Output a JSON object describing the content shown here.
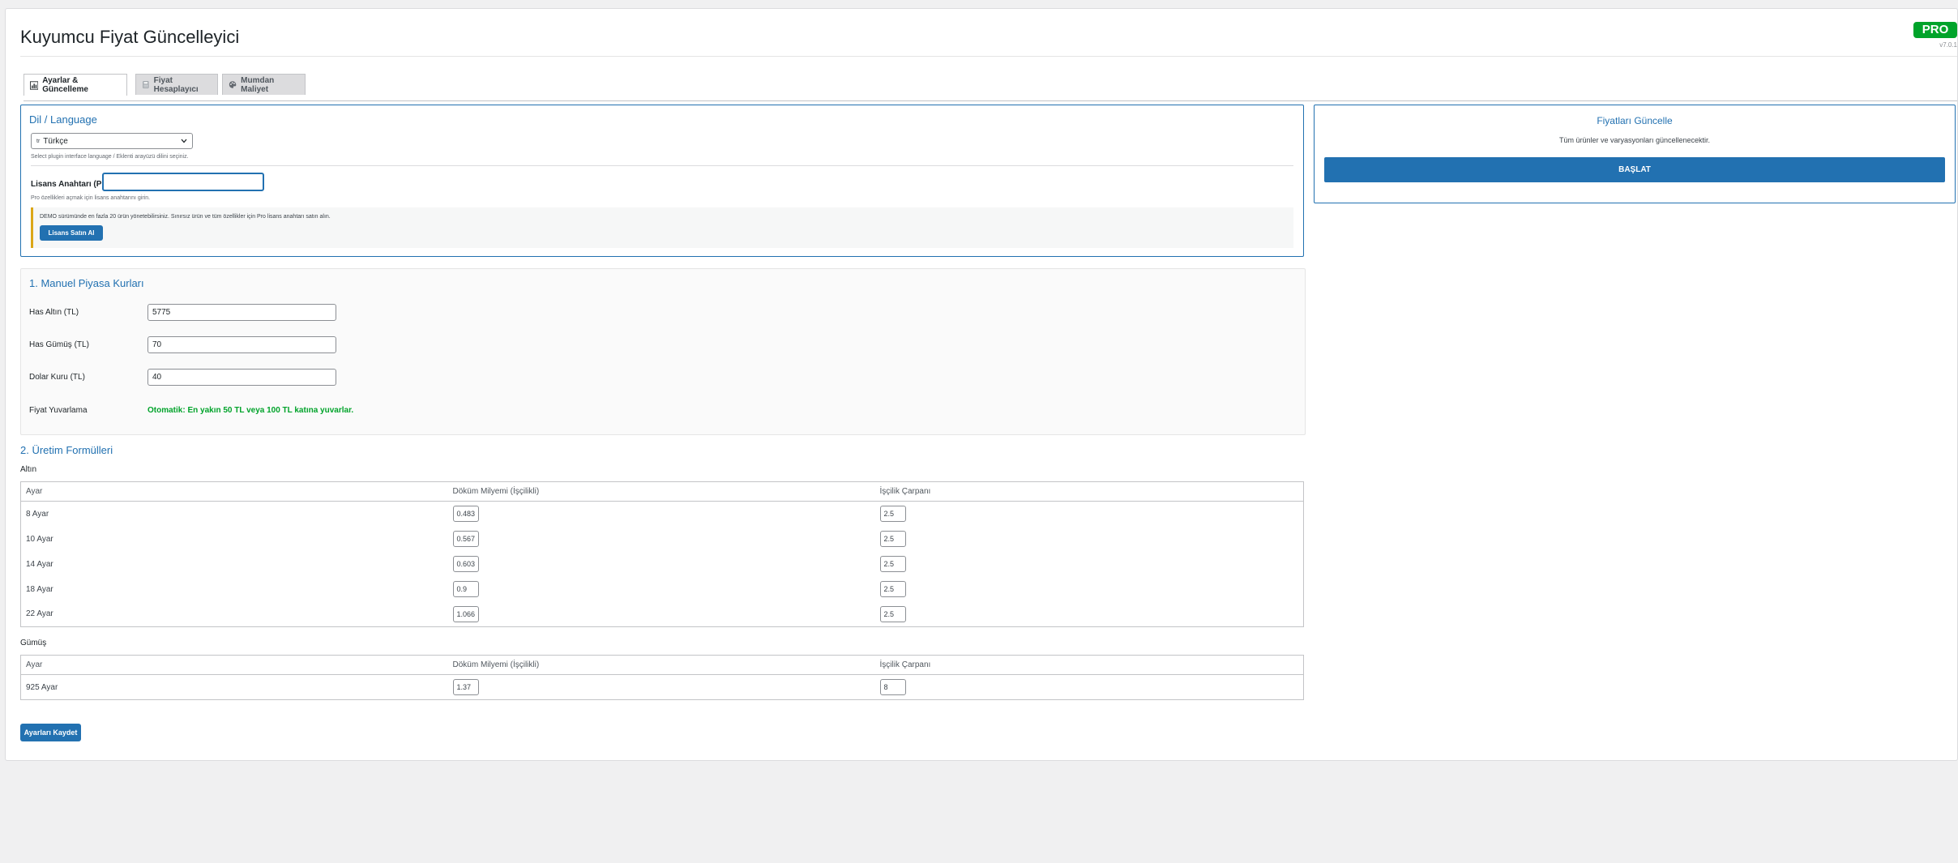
{
  "header": {
    "title": "Kuyumcu Fiyat Güncelleyici",
    "badge": "PRO",
    "version": "v7.0.1"
  },
  "tabs": [
    {
      "label": "Ayarlar & Güncelleme",
      "icon": "chart-icon"
    },
    {
      "label": "Fiyat Hesaplayıcı",
      "icon": "calculator-icon"
    },
    {
      "label": "Mumdan Maliyet",
      "icon": "palette-icon"
    }
  ],
  "language": {
    "title": "Dil / Language",
    "selected": "Türkçe",
    "flag": "tr",
    "help": "Select plugin interface language / Eklenti arayüzü dilini seçiniz."
  },
  "license": {
    "label": "Lisans Anahtarı (Pro):",
    "value": "",
    "help": "Pro özellikleri açmak için lisans anahtarını girin.",
    "notice": "DEMO sürümünde en fazla 20 ürün yönetebilirsiniz. Sınırsız ürün ve tüm özellikler için Pro lisans anahtarı satın alın.",
    "buy_label": "Lisans Satın Al"
  },
  "market": {
    "title": "1. Manuel Piyasa Kurları",
    "rows": [
      {
        "label": "Has Altın (TL)",
        "value": "5775"
      },
      {
        "label": "Has Gümüş (TL)",
        "value": "70"
      },
      {
        "label": "Dolar Kuru (TL)",
        "value": "40"
      }
    ],
    "rounding_label": "Fiyat Yuvarlama",
    "rounding_value": "Otomatik: En yakın 50 TL veya 100 TL katına yuvarlar."
  },
  "formulas": {
    "title": "2. Üretim Formülleri",
    "columns": [
      "Ayar",
      "Döküm Milyemi (İşçilikli)",
      "İşçilik Çarpanı"
    ],
    "gold_label": "Altın",
    "gold_rows": [
      {
        "ayar": "8 Ayar",
        "milyem": "0.483",
        "carpan": "2.5"
      },
      {
        "ayar": "10 Ayar",
        "milyem": "0.567",
        "carpan": "2.5"
      },
      {
        "ayar": "14 Ayar",
        "milyem": "0.603",
        "carpan": "2.5"
      },
      {
        "ayar": "18 Ayar",
        "milyem": "0.9",
        "carpan": "2.5"
      },
      {
        "ayar": "22 Ayar",
        "milyem": "1.066",
        "carpan": "2.5"
      }
    ],
    "silver_label": "Gümüş",
    "silver_rows": [
      {
        "ayar": "925 Ayar",
        "milyem": "1.37",
        "carpan": "8"
      }
    ],
    "save_label": "Ayarları Kaydet"
  },
  "update": {
    "title": "Fiyatları Güncelle",
    "desc": "Tüm ürünler ve varyasyonları güncellenecektir.",
    "start_label": "BAŞLAT"
  }
}
